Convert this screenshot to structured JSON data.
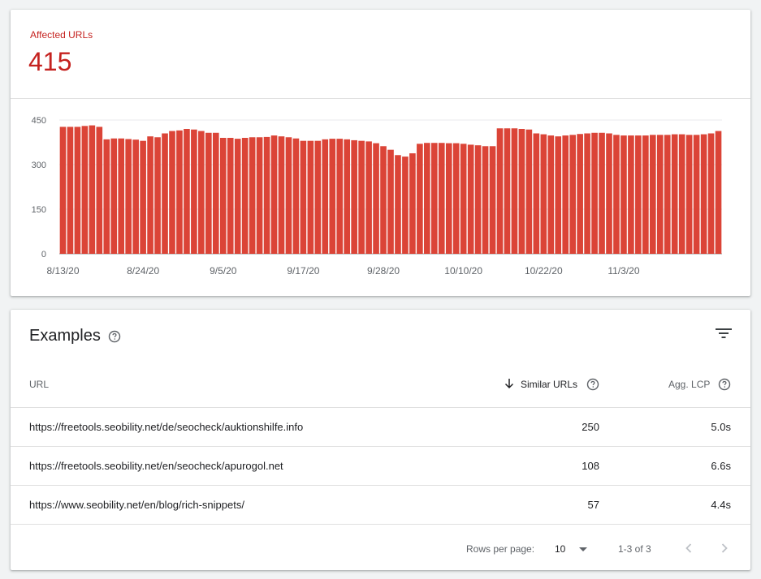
{
  "summary": {
    "metric_label": "Affected URLs",
    "metric_value": "415"
  },
  "chart_data": {
    "type": "bar",
    "color": "#db4437",
    "ylim": [
      0,
      450
    ],
    "y_ticks": [
      "450",
      "300",
      "150",
      "0"
    ],
    "x_tick_labels": [
      "8/13/20",
      "8/24/20",
      "9/5/20",
      "9/17/20",
      "9/28/20",
      "10/10/20",
      "10/22/20",
      "11/3/20"
    ],
    "values": [
      427,
      427,
      427,
      430,
      432,
      427,
      385,
      388,
      388,
      386,
      384,
      380,
      395,
      392,
      405,
      413,
      415,
      420,
      418,
      413,
      407,
      407,
      390,
      390,
      387,
      390,
      392,
      392,
      393,
      398,
      395,
      392,
      388,
      380,
      380,
      380,
      385,
      387,
      387,
      385,
      382,
      380,
      378,
      372,
      362,
      350,
      332,
      327,
      338,
      370,
      373,
      373,
      373,
      372,
      372,
      370,
      367,
      365,
      362,
      362,
      422,
      422,
      422,
      420,
      418,
      405,
      402,
      398,
      395,
      398,
      400,
      403,
      405,
      407,
      407,
      405,
      400,
      398,
      398,
      398,
      398,
      400,
      400,
      400,
      402,
      402,
      400,
      400,
      402,
      405,
      413
    ]
  },
  "examples": {
    "title": "Examples",
    "help_icon": "help-circle-icon",
    "filter_icon": "filter-list-icon",
    "columns": {
      "url": "URL",
      "similar": "Similar URLs",
      "lcp": "Agg. LCP"
    },
    "rows": [
      {
        "url": "https://freetools.seobility.net/de/seocheck/auktionshilfe.info",
        "similar": "250",
        "lcp": "5.0s"
      },
      {
        "url": "https://freetools.seobility.net/en/seocheck/apurogol.net",
        "similar": "108",
        "lcp": "6.6s"
      },
      {
        "url": "https://www.seobility.net/en/blog/rich-snippets/",
        "similar": "57",
        "lcp": "4.4s"
      }
    ],
    "pagination": {
      "rows_per_page_label": "Rows per page:",
      "rows_per_page_value": "10",
      "page_info": "1-3 of 3"
    }
  }
}
